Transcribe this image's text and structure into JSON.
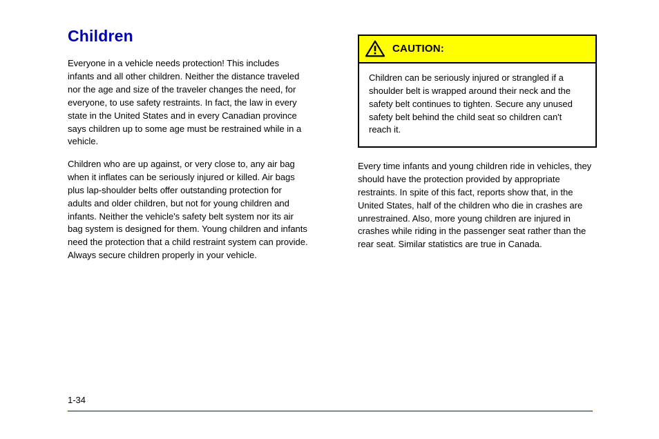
{
  "left": {
    "heading": "Children",
    "p1": "Everyone in a vehicle needs protection! This includes infants and all other children. Neither the distance traveled nor the age and size of the traveler changes the need, for everyone, to use safety restraints. In fact, the law in every state in the United States and in every Canadian province says children up to some age must be restrained while in a vehicle.",
    "p2": "Children who are up against, or very close to, any air bag when it inflates can be seriously injured or killed. Air bags plus lap-shoulder belts offer outstanding protection for adults and older children, but not for young children and infants. Neither the vehicle's safety belt system nor its air bag system is designed for them. Young children and infants need the protection that a child restraint system can provide. Always secure children properly in your vehicle."
  },
  "right": {
    "callout": {
      "title": "CAUTION:",
      "body": "Children can be seriously injured or strangled if a shoulder belt is wrapped around their neck and the safety belt continues to tighten. Secure any unused safety belt behind the child seat so children can't reach it."
    },
    "followup": "Every time infants and young children ride in vehicles, they should have the protection provided by appropriate restraints. In spite of this fact, reports show that, in the United States, half of the children who die in crashes are unrestrained. Also, more young children are injured in crashes while riding in the passenger seat rather than the rear seat. Similar statistics are true in Canada."
  },
  "pageNumber": "1-34"
}
